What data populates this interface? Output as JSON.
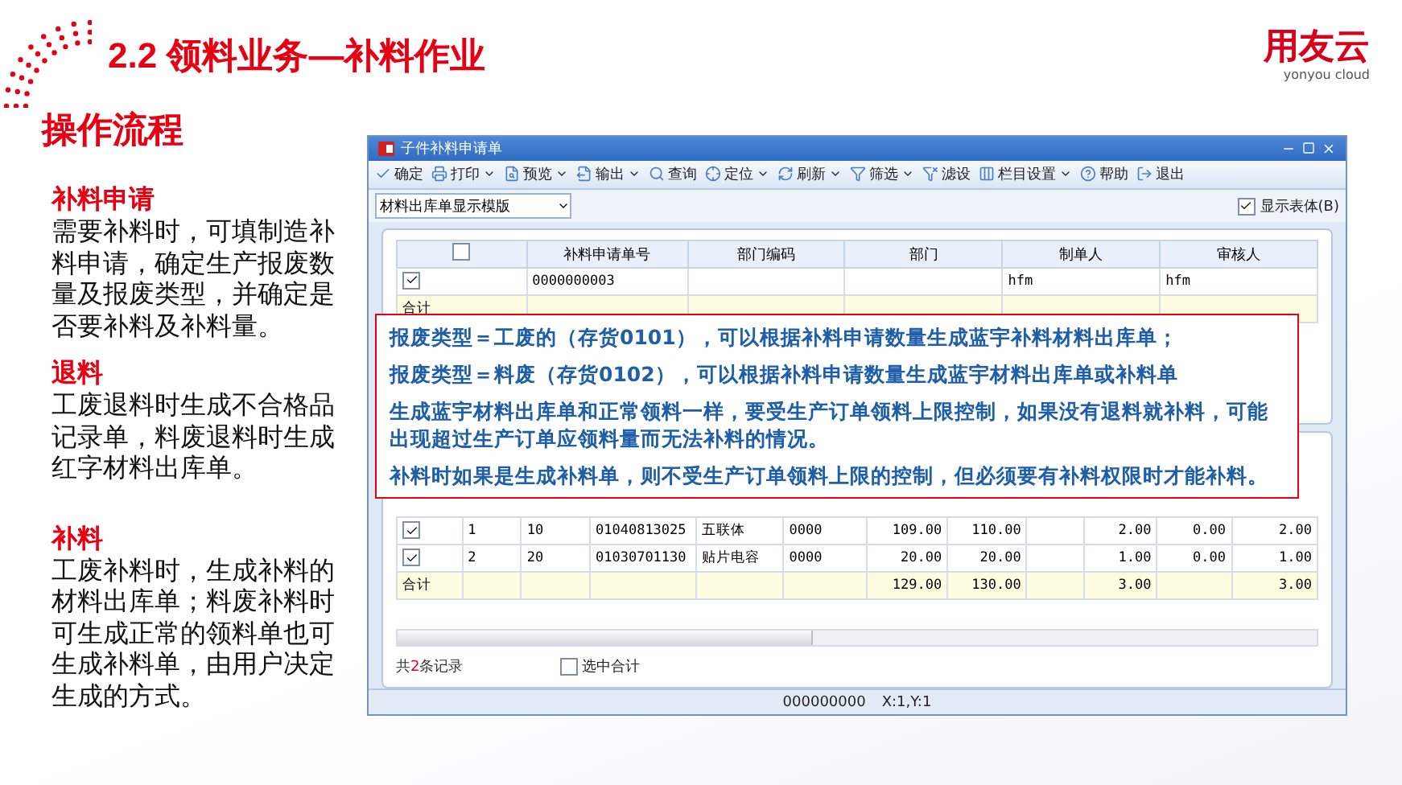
{
  "slide": {
    "title": "2.2 领料业务—补料作业",
    "logo": {
      "mark": "用友云",
      "tagline": "yonyou cloud"
    },
    "subtitle": "操作流程"
  },
  "sections": [
    {
      "heading": "补料申请",
      "body": "需要补料时，可填制造补料申请，确定生产报废数量及报废类型，并确定是否要补料及补料量。"
    },
    {
      "heading": "退料",
      "body": "工废退料时生成不合格品记录单，料废退料时生成红字材料出库单。"
    },
    {
      "heading": "补料",
      "body": "工废补料时，生成补料的材料出库单；料废补料时可生成正常的领料单也可生成补料单，由用户决定生成的方式。"
    }
  ],
  "window": {
    "title": "子件补料申请单",
    "toolbar": [
      {
        "label": "确定",
        "kind": "ok",
        "dropdown": false
      },
      {
        "label": "打印",
        "kind": "print",
        "dropdown": true
      },
      {
        "label": "预览",
        "kind": "preview",
        "dropdown": true
      },
      {
        "label": "输出",
        "kind": "export",
        "dropdown": true
      },
      {
        "label": "查询",
        "kind": "query",
        "dropdown": false
      },
      {
        "label": "定位",
        "kind": "locate",
        "dropdown": true
      },
      {
        "label": "刷新",
        "kind": "refresh",
        "dropdown": true
      },
      {
        "label": "筛选",
        "kind": "filter",
        "dropdown": true
      },
      {
        "label": "滤设",
        "kind": "filterset",
        "dropdown": false
      },
      {
        "label": "栏目设置",
        "kind": "columns",
        "dropdown": true
      },
      {
        "label": "帮助",
        "kind": "help",
        "dropdown": false
      },
      {
        "label": "退出",
        "kind": "exit",
        "dropdown": false
      }
    ],
    "template": "材料出库单显示模版",
    "show_body": {
      "label": "显示表体(B)",
      "checked": true
    },
    "header_table": {
      "columns": [
        "补料申请单号",
        "部门编码",
        "部门",
        "制单人",
        "审核人"
      ],
      "all_checked": false,
      "rows": [
        {
          "checked": true,
          "cells": [
            "0000000003",
            null,
            null,
            "hfm",
            "hfm"
          ]
        }
      ],
      "total_label": "合计"
    },
    "detail_table": {
      "rows": [
        {
          "checked": true,
          "cells": [
            "1",
            "10",
            "01040813025",
            "五联体",
            "0000",
            "109.00",
            "110.00",
            null,
            "2.00",
            "0.00",
            "2.00"
          ]
        },
        {
          "checked": true,
          "cells": [
            "2",
            "20",
            "01030701130",
            "贴片电容",
            "0000",
            "20.00",
            "20.00",
            null,
            "1.00",
            "0.00",
            "1.00"
          ]
        }
      ],
      "total_label": "合计",
      "totals": {
        "column_7": "129.00",
        "column_8": "130.00",
        "column_10": "3.00",
        "column_12": "3.00"
      }
    },
    "record_count": {
      "prefix": "共",
      "count": "2",
      "suffix": "条记录"
    },
    "select_total": {
      "label": "选中合计",
      "checked": false
    },
    "status": [
      "000000000",
      "X:1,Y:1"
    ]
  },
  "callout": [
    "报废类型＝工废的（存货0101），可以根据补料申请数量生成蓝宇补料材料出库单；",
    "报废类型＝料废（存货0102），可以根据补料申请数量生成蓝宇材料出库单或补料单",
    "生成蓝宇材料出库单和正常领料一样，要受生产订单领料上限控制，如果没有退料就补料，可能出现超过生产订单应领料量而无法补料的情况。",
    "补料时如果是生成补料单，则不受生产订单领料上限的控制，但必须要有补料权限时才能补料。"
  ]
}
